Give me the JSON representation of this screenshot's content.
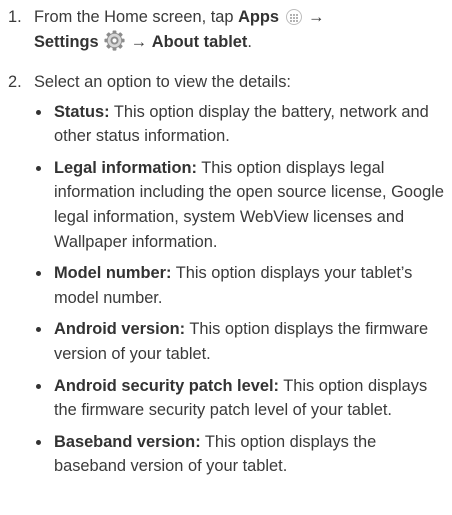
{
  "steps": [
    {
      "number": "1.",
      "lead": "From the Home screen, tap ",
      "apps_label": "Apps",
      "arrow1": "→",
      "settings_label": "Settings",
      "arrow2": "→",
      "about_label": "About tablet",
      "end": "."
    },
    {
      "number": "2.",
      "text": "Select an option to view the details:",
      "options": [
        {
          "title": "Status:",
          "desc": " This option display the battery, network and other status information."
        },
        {
          "title": "Legal information:",
          "desc": " This option displays legal information including the open source license, Google legal information, system WebView licenses and Wallpaper information."
        },
        {
          "title": "Model number:",
          "desc": " This option displays your tablet’s model number."
        },
        {
          "title": "Android version:",
          "desc": " This option displays the firmware version of your tablet."
        },
        {
          "title": "Android security patch level:",
          "desc": " This option displays the firmware security patch level of your tablet."
        },
        {
          "title": "Baseband version:",
          "desc": " This option displays the baseband version of your tablet."
        }
      ]
    }
  ],
  "icons": {
    "apps": "apps-grid-icon",
    "settings": "settings-gear-icon"
  },
  "colors": {
    "text": "#3a3a3a",
    "bold": "#333333",
    "gear_light": "#d7d7d7",
    "gear_dark": "#8c8c8c"
  }
}
